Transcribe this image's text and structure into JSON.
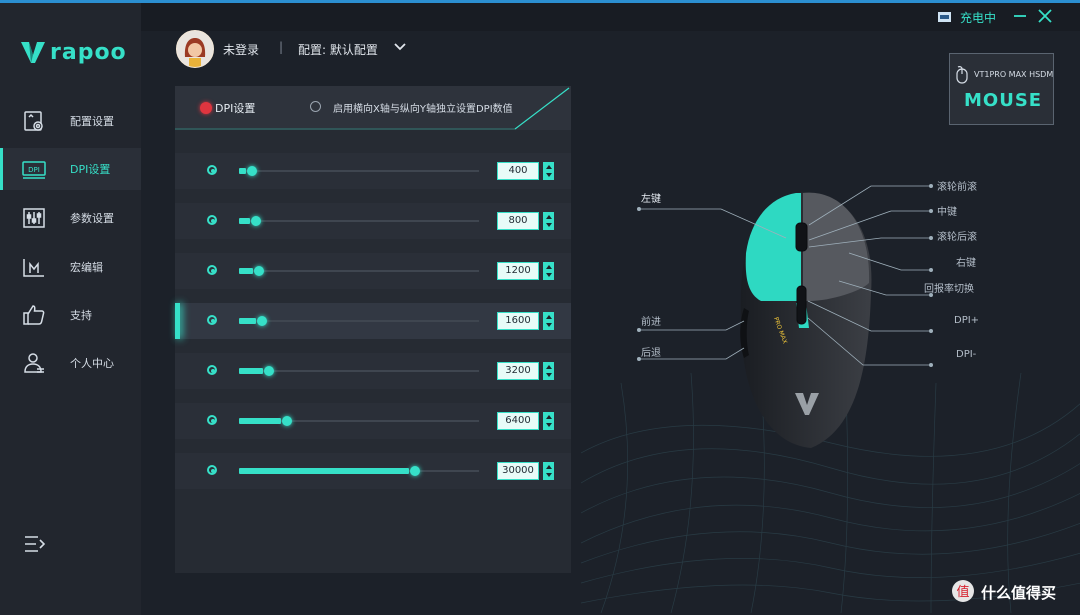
{
  "app": {
    "brand": "rapoo",
    "accent": "#36e0c8",
    "background": "#1b1f27"
  },
  "sidebar": {
    "items": [
      {
        "label": "配置设置",
        "icon": "config-settings-icon",
        "active": false
      },
      {
        "label": "DPI设置",
        "icon": "dpi-icon",
        "active": true
      },
      {
        "label": "参数设置",
        "icon": "sliders-icon",
        "active": false
      },
      {
        "label": "宏编辑",
        "icon": "macro-icon",
        "active": false
      },
      {
        "label": "支持",
        "icon": "thumbs-up-icon",
        "active": false
      },
      {
        "label": "个人中心",
        "icon": "user-icon",
        "active": false
      }
    ],
    "collapse_icon": "menu-collapse-icon"
  },
  "header": {
    "login_status": "未登录",
    "separator": "|",
    "profile_label": "配置: 默认配置",
    "charging_status": "充电中"
  },
  "device": {
    "name": "VT1PRO MAX HSDM",
    "title": "MOUSE"
  },
  "dpi_panel": {
    "mode_label": "DPI设置",
    "independent_axis_label": "启用横向X轴与纵向Y轴独立设置DPI数值",
    "max_dpi": 30000,
    "levels": [
      {
        "value": "400",
        "fraction": 0.03,
        "active": false
      },
      {
        "value": "800",
        "fraction": 0.045,
        "active": false
      },
      {
        "value": "1200",
        "fraction": 0.058,
        "active": false
      },
      {
        "value": "1600",
        "fraction": 0.07,
        "active": false
      },
      {
        "value": "3200",
        "fraction": 0.1,
        "active": false
      },
      {
        "value": "6400",
        "fraction": 0.175,
        "active": false
      },
      {
        "value": "30000",
        "fraction": 0.71,
        "active": false
      }
    ],
    "selected_index": 3
  },
  "mouse_labels": {
    "left_button": "左键",
    "wheel_forward": "滚轮前滚",
    "middle": "中键",
    "wheel_back": "滚轮后滚",
    "right_button": "右键",
    "report_rate": "回报率切换",
    "forward": "前进",
    "back": "后退",
    "dpi_plus": "DPI+",
    "dpi_minus": "DPI-",
    "mouse_side_text": "PRO MAX"
  },
  "watermark": "什么值得买"
}
